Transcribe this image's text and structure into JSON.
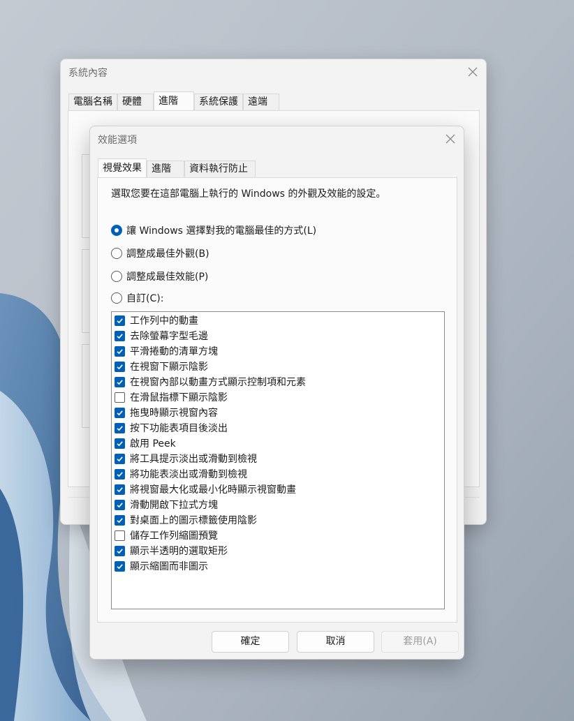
{
  "back_window": {
    "title": "系統內容",
    "tabs": [
      "電腦名稱",
      "硬體",
      "進階",
      "系統保護",
      "遠端"
    ],
    "active_tab": "進階"
  },
  "dialog": {
    "title": "效能選項",
    "tabs": [
      "視覺效果",
      "進階",
      "資料執行防止"
    ],
    "active_tab": "視覺效果",
    "description": "選取您要在這部電腦上執行的 Windows 的外觀及效能的設定。",
    "radios": [
      {
        "label": "讓 Windows 選擇對我的電腦最佳的方式(L)",
        "selected": true
      },
      {
        "label": "調整成最佳外觀(B)",
        "selected": false
      },
      {
        "label": "調整成最佳效能(P)",
        "selected": false
      },
      {
        "label": "自訂(C):",
        "selected": false
      }
    ],
    "options": [
      {
        "label": "工作列中的動畫",
        "checked": true
      },
      {
        "label": "去除螢幕字型毛邊",
        "checked": true
      },
      {
        "label": "平滑捲動的清單方塊",
        "checked": true
      },
      {
        "label": "在視窗下顯示陰影",
        "checked": true
      },
      {
        "label": "在視窗內部以動畫方式顯示控制項和元素",
        "checked": true
      },
      {
        "label": "在滑鼠指標下顯示陰影",
        "checked": false
      },
      {
        "label": "拖曳時顯示視窗內容",
        "checked": true
      },
      {
        "label": "按下功能表項目後淡出",
        "checked": true
      },
      {
        "label": "啟用 Peek",
        "checked": true
      },
      {
        "label": "將工具提示淡出或滑動到檢視",
        "checked": true
      },
      {
        "label": "將功能表淡出或滑動到檢視",
        "checked": true
      },
      {
        "label": "將視窗最大化或最小化時顯示視窗動畫",
        "checked": true
      },
      {
        "label": "滑動開啟下拉式方塊",
        "checked": true
      },
      {
        "label": "對桌面上的圖示標籤使用陰影",
        "checked": true
      },
      {
        "label": "儲存工作列縮圖預覽",
        "checked": false
      },
      {
        "label": "顯示半透明的選取矩形",
        "checked": true
      },
      {
        "label": "顯示縮圖而非圖示",
        "checked": true
      }
    ],
    "buttons": {
      "ok": "確定",
      "cancel": "取消",
      "apply": "套用(A)"
    }
  },
  "colors": {
    "accent": "#005fb8",
    "window_bg": "#f3f3f3",
    "panel_bg": "#fbfbfb"
  },
  "icons": [
    "close-icon",
    "checkmark-icon"
  ]
}
